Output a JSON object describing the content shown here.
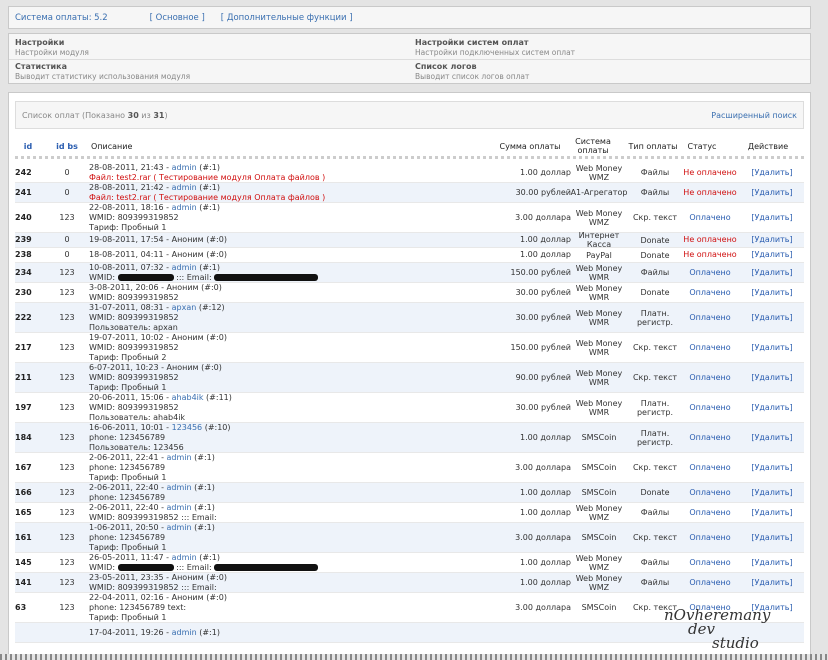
{
  "top": {
    "label": "Система оплаты:",
    "version": "5.2",
    "link1": "[ Основное ]",
    "link2": "[ Дополнительные функции ]"
  },
  "menu": {
    "items": [
      {
        "title": "Настройки",
        "desc": "Настройки модуля"
      },
      {
        "title": "Настройки систем оплат",
        "desc": "Настройки подключенных систем оплат"
      },
      {
        "title": "Статистика",
        "desc": "Выводит статистику использования модуля"
      },
      {
        "title": "Список логов",
        "desc": "Выводит список логов оплат"
      }
    ]
  },
  "list": {
    "title": "Список оплат (Показано ",
    "shown": "30",
    "of": " из ",
    "total": "31",
    "close": ")",
    "advanced": "Расширенный поиск",
    "cols": [
      "id",
      "id bs",
      "Описание",
      "Сумма оплаты",
      "Система оплаты",
      "Тип оплаты",
      "Статус",
      "Действие"
    ]
  },
  "rows": [
    {
      "id": "242",
      "bs": "0",
      "l1": "28-08-2011, 21:43 - ",
      "l1u": "admin",
      "l1s": " (#:1)",
      "l2": "Файл: test2.rar ( Тестирование модуля Оплата файлов )",
      "l2red": true,
      "sum": "1.00 доллар",
      "sys": "Web Money WMZ",
      "type": "Файлы",
      "st": "Не оплачено",
      "paid": false,
      "act": "[Удалить]"
    },
    {
      "id": "241",
      "bs": "0",
      "l1": "28-08-2011, 21:42 - ",
      "l1u": "admin",
      "l1s": " (#:1)",
      "l2": "Файл: test2.rar ( Тестирование модуля Оплата файлов )",
      "l2red": true,
      "sum": "30.00 рублей",
      "sys": "A1-Агрегатор",
      "type": "Файлы",
      "st": "Не оплачено",
      "paid": false,
      "act": "[Удалить]"
    },
    {
      "id": "240",
      "bs": "123",
      "l1": "22-08-2011, 18:16 - ",
      "l1u": "admin",
      "l1s": " (#:1)",
      "l2": "WMID: 809399319852",
      "l3": "Тариф: Пробный 1",
      "sum": "3.00 доллара",
      "sys": "Web Money WMZ",
      "type": "Скр. текст",
      "st": "Оплачено",
      "paid": true,
      "act": "[Удалить]"
    },
    {
      "id": "239",
      "bs": "0",
      "l1": "19-08-2011, 17:54 - Аноним (#:0)",
      "sum": "1.00 доллар",
      "sys": "Интернет Касса",
      "type": "Donate",
      "st": "Не оплачено",
      "paid": false,
      "act": "[Удалить]"
    },
    {
      "id": "238",
      "bs": "0",
      "l1": "18-08-2011, 04:11 - Аноним (#:0)",
      "sum": "1.00 доллар",
      "sys": "PayPal",
      "type": "Donate",
      "st": "Не оплачено",
      "paid": false,
      "act": "[Удалить]"
    },
    {
      "id": "234",
      "bs": "123",
      "l1": "10-08-2011, 07:32 - ",
      "l1u": "admin",
      "l1s": " (#:1)",
      "l2": "WMID: ",
      "blot": true,
      "l2b": " ::: Email: ",
      "sum": "150.00 рублей",
      "sys": "Web Money WMR",
      "type": "Файлы",
      "st": "Оплачено",
      "paid": true,
      "act": "[Удалить]"
    },
    {
      "id": "230",
      "bs": "123",
      "l1": "3-08-2011, 20:06 - Аноним (#:0)",
      "l2": "WMID: 809399319852",
      "sum": "30.00 рублей",
      "sys": "Web Money WMR",
      "type": "Donate",
      "st": "Оплачено",
      "paid": true,
      "act": "[Удалить]"
    },
    {
      "id": "222",
      "bs": "123",
      "l1": "31-07-2011, 08:31 - ",
      "l1u": "apxan",
      "l1s": " (#:12)",
      "l2": "WMID: 809399319852",
      "l3": "Пользователь: apxan",
      "sum": "30.00 рублей",
      "sys": "Web Money WMR",
      "type": "Платн. регистр.",
      "st": "Оплачено",
      "paid": true,
      "act": "[Удалить]"
    },
    {
      "id": "217",
      "bs": "123",
      "l1": "19-07-2011, 10:02 - Аноним (#:0)",
      "l2": "WMID: 809399319852",
      "l3": "Тариф: Пробный 2",
      "sum": "150.00 рублей",
      "sys": "Web Money WMR",
      "type": "Скр. текст",
      "st": "Оплачено",
      "paid": true,
      "act": "[Удалить]"
    },
    {
      "id": "211",
      "bs": "123",
      "l1": "6-07-2011, 10:23 - Аноним (#:0)",
      "l2": "WMID: 809399319852",
      "l3": "Тариф: Пробный 1",
      "sum": "90.00 рублей",
      "sys": "Web Money WMR",
      "type": "Скр. текст",
      "st": "Оплачено",
      "paid": true,
      "act": "[Удалить]"
    },
    {
      "id": "197",
      "bs": "123",
      "l1": "20-06-2011, 15:06 - ",
      "l1u": "ahab4ik",
      "l1s": " (#:11)",
      "l2": "WMID: 809399319852",
      "l3": "Пользователь: ahab4ik",
      "sum": "30.00 рублей",
      "sys": "Web Money WMR",
      "type": "Платн. регистр.",
      "st": "Оплачено",
      "paid": true,
      "act": "[Удалить]"
    },
    {
      "id": "184",
      "bs": "123",
      "l1": "16-06-2011, 10:01 - ",
      "l1u": "123456",
      "l1s": " (#:10)",
      "l2": "phone: 123456789",
      "l3": "Пользователь: 123456",
      "sum": "1.00 доллар",
      "sys": "SMSCoin",
      "type": "Платн. регистр.",
      "st": "Оплачено",
      "paid": true,
      "act": "[Удалить]"
    },
    {
      "id": "167",
      "bs": "123",
      "l1": "2-06-2011, 22:41 - ",
      "l1u": "admin",
      "l1s": " (#:1)",
      "l2": "phone: 123456789",
      "l3": "Тариф: Пробный 1",
      "sum": "3.00 доллара",
      "sys": "SMSCoin",
      "type": "Скр. текст",
      "st": "Оплачено",
      "paid": true,
      "act": "[Удалить]"
    },
    {
      "id": "166",
      "bs": "123",
      "l1": "2-06-2011, 22:40 - ",
      "l1u": "admin",
      "l1s": " (#:1)",
      "l2": "phone: 123456789",
      "sum": "1.00 доллар",
      "sys": "SMSCoin",
      "type": "Donate",
      "st": "Оплачено",
      "paid": true,
      "act": "[Удалить]"
    },
    {
      "id": "165",
      "bs": "123",
      "l1": "2-06-2011, 22:40 - ",
      "l1u": "admin",
      "l1s": " (#:1)",
      "l2": "WMID: 809399319852 ::: Email:",
      "sum": "1.00 доллар",
      "sys": "Web Money WMZ",
      "type": "Файлы",
      "st": "Оплачено",
      "paid": true,
      "act": "[Удалить]"
    },
    {
      "id": "161",
      "bs": "123",
      "l1": "1-06-2011, 20:50 - ",
      "l1u": "admin",
      "l1s": " (#:1)",
      "l2": "phone: 123456789",
      "l3": "Тариф: Пробный 1",
      "sum": "3.00 доллара",
      "sys": "SMSCoin",
      "type": "Скр. текст",
      "st": "Оплачено",
      "paid": true,
      "act": "[Удалить]"
    },
    {
      "id": "145",
      "bs": "123",
      "l1": "26-05-2011, 11:47 - ",
      "l1u": "admin",
      "l1s": " (#:1)",
      "l2": "WMID: ",
      "blot": true,
      "l2b": " ::: Email: ",
      "sum": "1.00 доллар",
      "sys": "Web Money WMZ",
      "type": "Файлы",
      "st": "Оплачено",
      "paid": true,
      "act": "[Удалить]"
    },
    {
      "id": "141",
      "bs": "123",
      "l1": "23-05-2011, 23:35 - Аноним (#:0)",
      "l2": "WMID: 809399319852 ::: Email:",
      "sum": "1.00 доллар",
      "sys": "Web Money WMZ",
      "type": "Файлы",
      "st": "Оплачено",
      "paid": true,
      "act": "[Удалить]"
    },
    {
      "id": "63",
      "bs": "123",
      "l1": "22-04-2011, 02:16 - Аноним (#:0)",
      "l2": "phone: 123456789 text:",
      "l3": "Тариф: Пробный 1",
      "sum": "3.00 доллара",
      "sys": "SMSCoin",
      "type": "Скр. текст",
      "st": "Оплачено",
      "paid": true,
      "act": "[Удалить]"
    },
    {
      "id": "",
      "bs": "",
      "l1": "17-04-2011, 19:26 - ",
      "l1u": "admin",
      "l1s": " (#:1)",
      "sum": "",
      "sys": "",
      "type": "",
      "st": "",
      "paid": true,
      "act": ""
    }
  ],
  "watermark": {
    "l1": "nOvheremany",
    "l2": "dev",
    "l3": "studio"
  }
}
